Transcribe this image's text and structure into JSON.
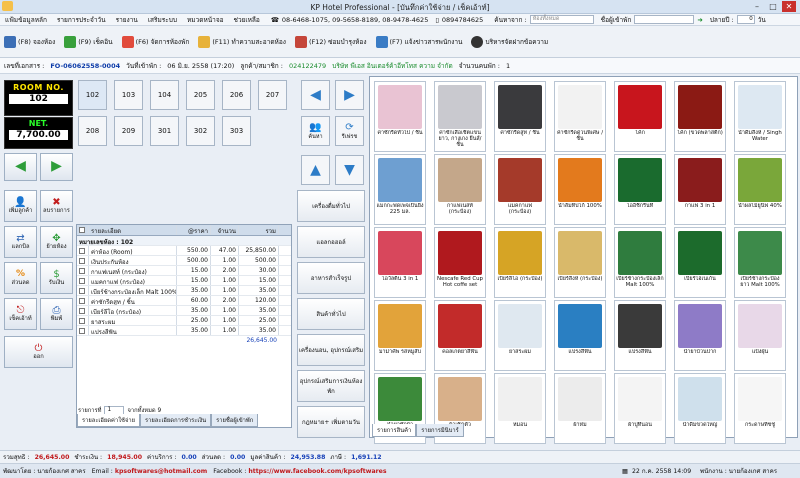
{
  "window": {
    "title": "KP Hotel Professional - [บันทึกค่าใช้จ่าย / เช็คเอ้าท์]"
  },
  "menu": {
    "items": [
      "แฟ้มข้อมูลหลัก",
      "รายการประจำวัน",
      "รายงาน",
      "เสริมระบบ",
      "หมวดหน้าจอ",
      "ช่วยเหลือ"
    ],
    "phone1": "08-6468-1075, 09-5658-8189, 08-9478-4625",
    "phone2": "0894784625",
    "search_label": "ค้นหาจาก :",
    "search_placeholder": "ห้องทั้งหมด",
    "name_label": "ชื่อผู้เข้าพัก",
    "year_label": "ปลายปี :",
    "year_value": "0",
    "day_label": "วัน"
  },
  "toolbar": {
    "row1": [
      {
        "label": "(F8) จองห้อง"
      },
      {
        "label": "(F9) เช็คอิน"
      },
      {
        "label": "(F6) จัดการห้องพัก"
      },
      {
        "label": "(F11) ทำความสะอาดห้อง"
      },
      {
        "label": "(F12) ซ่อมบำรุงห้อง"
      },
      {
        "label": "(F7) แจ้งข่าวสารพนักงาน"
      },
      {
        "label": "บริหารจัดฝากข้อความ"
      }
    ]
  },
  "info": {
    "receipt_label": "เลขที่เอกสาร :",
    "receipt_no": "FO-06062558-0004",
    "checkin_label": "วันที่เข้าพัก :",
    "checkin": "06 มิ.ย. 2558 (17:20)",
    "customer_label": "ลูกค้า/สมาชิก :",
    "customer_code": "024122479",
    "company": "บริษัท พีเอส อินเตอร์ค้าอีทโทส ความ จำกัด",
    "guests_label": "จำนวนคนพัก :",
    "guests": "1"
  },
  "room_panel": {
    "room_label": "ROOM NO.",
    "room_no": "102",
    "net_label": "NET.",
    "net_value": "7,700.00"
  },
  "side_buttons": [
    "เพิ่มลูกค้า",
    "ลบรายการ",
    "แลกบิล",
    "ย้ายห้อง",
    "ส่วนลด",
    "รับเงิน",
    "เช็คเอ้าท์",
    "พิมพ์",
    "ออก"
  ],
  "rooms": [
    "102",
    "103",
    "104",
    "205",
    "206",
    "207",
    "208",
    "209",
    "301",
    "302",
    "303"
  ],
  "arrow_buttons": {
    "find": "ค้นหา",
    "refresh": "รีเฟรช"
  },
  "categories": [
    "เครื่องดื่มทั่วไป",
    "แอลกอฮอล์",
    "อาหารสำเร็จรูป",
    "สินค้าทั่วไป",
    "เครื่องนอน, อุปกรณ์เสริม",
    "อุปกรณ์เสริมการเงินห้องพัก",
    "กฎหมาย+ เพิ่มตามวัน"
  ],
  "grid": {
    "headers": [
      "รายละเอียด",
      "@ราคา",
      "จำนวน",
      "รวม"
    ],
    "group": "หมายเลขห้อง : 102",
    "rows": [
      {
        "name": "ค่าห้อง (Room)",
        "price": "550.00",
        "qty": "47.00",
        "total": "25,850.00"
      },
      {
        "name": "เงินประกันห้อง",
        "price": "500.00",
        "qty": "1.00",
        "total": "500.00"
      },
      {
        "name": "กาแฟเนสท์ (กระป๋อง)",
        "price": "15.00",
        "qty": "2.00",
        "total": "30.00"
      },
      {
        "name": "แมคกาแฟ (กระป๋อง)",
        "price": "15.00",
        "qty": "1.00",
        "total": "15.00"
      },
      {
        "name": "เบียร์ช้างกระป๋องเล็ก Malt 100%",
        "price": "35.00",
        "qty": "1.00",
        "total": "35.00"
      },
      {
        "name": "ค่าซักรีดสูท / ชิ้น",
        "price": "60.00",
        "qty": "2.00",
        "total": "120.00"
      },
      {
        "name": "เบียร์ลีโอ (กระป๋อง)",
        "price": "35.00",
        "qty": "1.00",
        "total": "35.00"
      },
      {
        "name": "ยาสระผม",
        "price": "25.00",
        "qty": "1.00",
        "total": "25.00"
      },
      {
        "name": "แปรงสีฟัน",
        "price": "35.00",
        "qty": "1.00",
        "total": "35.00"
      }
    ],
    "sum": "26,645.00",
    "pager_label": "รายการที่",
    "pager_value": "1",
    "pager_of": "จากทั้งหมด 9",
    "tabs": [
      "รายละเอียดค่าใช้จ่าย",
      "รายละเอียดการชำระเงิน",
      "รายชื่อผู้เข้าพัก"
    ]
  },
  "products": [
    {
      "name": "ค่าซักรีดทั่วไป / ชิ้น",
      "color": "#e9c3d3"
    },
    {
      "name": "ค่าซักเสื้อเชิ้ตแขนยาว, กางเกง ยีนส์/ ชิ้น",
      "color": "#c9c9cf"
    },
    {
      "name": "ค่าซักรีดสูท / ชิ้น",
      "color": "#3a3a3d"
    },
    {
      "name": "ค่าซักรีดด่วนพิเศษ / ชิ้น",
      "color": "#f2f2f2"
    },
    {
      "name": "โค้ก",
      "color": "#c8151d"
    },
    {
      "name": "โค้ก (ขวดพลาสติก)",
      "color": "#8b1a14"
    },
    {
      "name": "น้ำดื่มสิงห์ / Singh Water",
      "color": "#dde8f2"
    },
    {
      "name": "แมกกะฟดเพจเป็นยิ่ง 225 มล.",
      "color": "#6e9fd1"
    },
    {
      "name": "กาแฟเนสท์ (กระป๋อง)",
      "color": "#c4a78a"
    },
    {
      "name": "แมคกาแฟ (กระป๋อง)",
      "color": "#a53a2a"
    },
    {
      "name": "น้ำส้มทิปโก้ 100%",
      "color": "#e37a1d"
    },
    {
      "name": "โออิชิกรีนที",
      "color": "#1a6b2e"
    },
    {
      "name": "กาแฟ 3 in 1",
      "color": "#8a1c1c"
    },
    {
      "name": "น้ำผลไม้ยูนิฟ 40%",
      "color": "#7aa73a"
    },
    {
      "name": "โอวัลติน 3 in 1",
      "color": "#d8475c"
    },
    {
      "name": "Nescafe Red Cup Hot coffe set",
      "color": "#b0191e"
    },
    {
      "name": "เบียร์ลีโอ (กระป๋อง)",
      "color": "#d6a425"
    },
    {
      "name": "เบียร์สิงห์ (กระป๋อง)",
      "color": "#d9b96a"
    },
    {
      "name": "เบียร์ช้างกระป๋องเล็ก Malt 100%",
      "color": "#2f7c3e"
    },
    {
      "name": "เบียร์ไฮเนเก้น",
      "color": "#1c6b2c"
    },
    {
      "name": "เบียร์ช้างกระป๋อง ยาว Malt 100%",
      "color": "#3d8a4a"
    },
    {
      "name": "มาม่าคัพ รสหมูสับ",
      "color": "#e2a33a"
    },
    {
      "name": "คอลเกตยาสีฟัน",
      "color": "#c22b2a"
    },
    {
      "name": "ยาสระผม",
      "color": "#dfe8f0"
    },
    {
      "name": "แปรงสีฟัน",
      "color": "#2a7fc2"
    },
    {
      "name": "แปรงสีฟัน",
      "color": "#3a3a3a"
    },
    {
      "name": "น้ำยาบ้วนปาก",
      "color": "#8e7bc7"
    },
    {
      "name": "แป้งฝุ่น",
      "color": "#e8d8e8"
    },
    {
      "name": "น้ำยาซักผ้า",
      "color": "#3c8a3a"
    },
    {
      "name": "ผ้าเช็ดตัว",
      "color": "#d8b08a"
    },
    {
      "name": "หมอน",
      "color": "#f0f0f0"
    },
    {
      "name": "ผ้าห่ม",
      "color": "#ececec"
    },
    {
      "name": "ผ้าปูที่นอน",
      "color": "#f4f4f4"
    },
    {
      "name": "น้ำดื่มขวดใหญ่",
      "color": "#cfe0ec"
    },
    {
      "name": "กระดาษทิชชู่",
      "color": "#f6f6f6"
    }
  ],
  "product_tabs": [
    "รายการสินค้า",
    "รายการมินิบาร์"
  ],
  "status": {
    "deposit_label": "รวมสุทธิ :",
    "deposit": "26,645.00",
    "paid_label": "ชำระเงิน :",
    "paid": "18,945.00",
    "service_label": "ค่าบริการ :",
    "service": "0.00",
    "discount_label": "ส่วนลด :",
    "discount": "0.00",
    "before_label": "มูลค่าสินค้า :",
    "before": "24,953.88",
    "vat_label": "ภาษี :",
    "vat": "1,691.12"
  },
  "footer": {
    "dev_label": "พัฒนาโดย : นายก้องเกศ สาคร",
    "email_label": "Email :",
    "email": "kpsoftwares@hotmail.com",
    "fb_label": "Facebook :",
    "fb": "https://www.facebook.com/kpsoftwares",
    "date": "22 ก.ค. 2558 14:09",
    "staff": "พนักงาน : นายก้องเกศ สาคร"
  }
}
